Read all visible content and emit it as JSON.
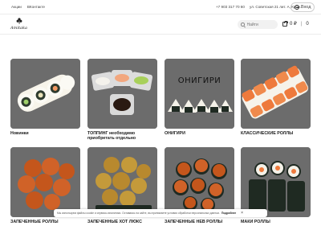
{
  "topbar": {
    "links": [
      "Акции",
      "ВКонтакте"
    ],
    "phone": "+7 903 317 70 60",
    "address": "ул. Советская 21 лит. А, Крон...",
    "login_label": "Вход"
  },
  "header": {
    "logo_text": "Amitaka",
    "search_placeholder": "Найти",
    "cart_count": "0 ₽",
    "favorites_count": "0"
  },
  "categories": [
    {
      "label": "Новинки"
    },
    {
      "label": "ТОППИНГ необходимо приобретать отдельно"
    },
    {
      "label": "ОНИГИРИ",
      "image_caption": "ОНИГИРИ"
    },
    {
      "label": "КЛАССИЧЕСКИЕ РОЛЛЫ"
    },
    {
      "label": "ЗАПЕЧЕННЫЕ РОЛЛЫ"
    },
    {
      "label": "ЗАПЕЧЕННЫЕ ХОТ ЛЮКС"
    },
    {
      "label": "ЗАПЕЧЕННЫЕ НЕВ РОЛЛЫ"
    },
    {
      "label": "МАКИ РОЛЛЫ"
    }
  ],
  "cookie": {
    "text": "Мы используем файлы cookie и сервисы аналитики. Оставаясь на сайте, вы принимаете условия обработки персональных данных.",
    "more_label": "Подробнее",
    "close_label": "×"
  },
  "colors": {
    "card_bg": "#6c6c6c",
    "salmon": "#ee7a3c",
    "baked": "#c4561c",
    "rice": "#f4f1e8",
    "nori": "#1f2a22"
  }
}
